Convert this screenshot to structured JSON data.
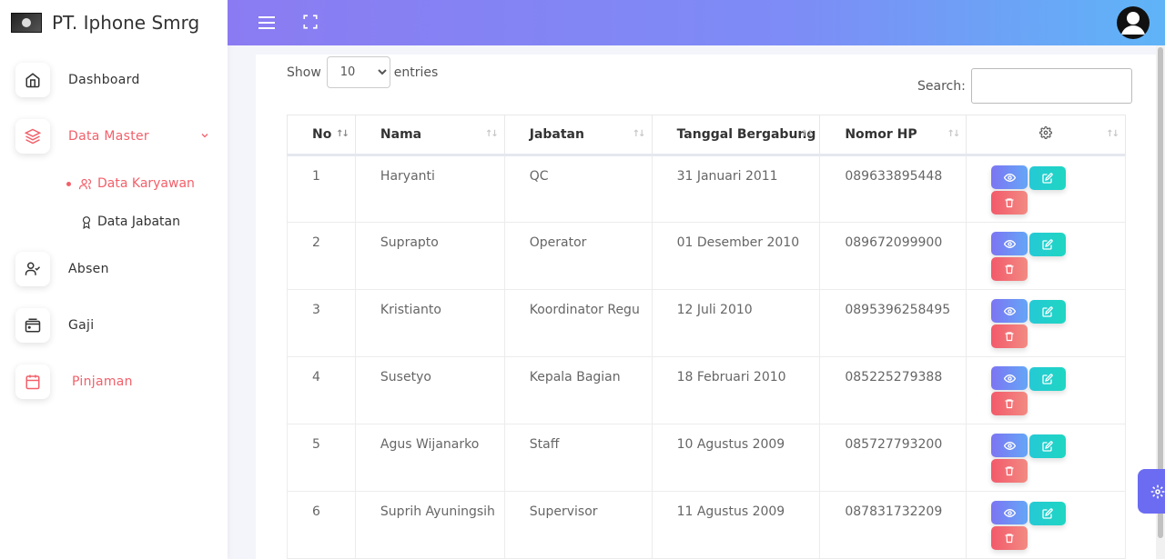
{
  "brand": {
    "title": "PT. Iphone Smrg"
  },
  "sidebar": {
    "items": [
      {
        "label": "Dashboard",
        "icon": "home-icon"
      },
      {
        "label": "Data Master",
        "icon": "layers-icon"
      },
      {
        "label": "Absen",
        "icon": "user-check-icon"
      },
      {
        "label": "Gaji",
        "icon": "wallet-icon"
      },
      {
        "label": "Pinjaman",
        "icon": "calendar-icon"
      }
    ],
    "submenu": [
      {
        "label": "Data Karyawan",
        "icon": "users-icon"
      },
      {
        "label": "Data Jabatan",
        "icon": "award-icon"
      }
    ]
  },
  "table_controls": {
    "show_label": "Show",
    "entries_value": "10",
    "entries_label": "entries",
    "search_label": "Search:"
  },
  "table": {
    "headers": [
      "No",
      "Nama",
      "Jabatan",
      "Tanggal Bergabung",
      "Nomor HP"
    ],
    "rows": [
      {
        "no": "1",
        "nama": "Haryanti",
        "jabatan": "QC",
        "tanggal": "31 Januari 2011",
        "hp": "089633895448"
      },
      {
        "no": "2",
        "nama": "Suprapto",
        "jabatan": "Operator",
        "tanggal": "01 Desember 2010",
        "hp": "089672099900"
      },
      {
        "no": "3",
        "nama": "Kristianto",
        "jabatan": "Koordinator Regu",
        "tanggal": "12 Juli 2010",
        "hp": "0895396258495"
      },
      {
        "no": "4",
        "nama": "Susetyo",
        "jabatan": "Kepala Bagian",
        "tanggal": "18 Februari 2010",
        "hp": "085225279388"
      },
      {
        "no": "5",
        "nama": "Agus Wijanarko",
        "jabatan": "Staff",
        "tanggal": "10 Agustus 2009",
        "hp": "085727793200"
      },
      {
        "no": "6",
        "nama": "Suprih Ayuningsih",
        "jabatan": "Supervisor",
        "tanggal": "11 Agustus 2009",
        "hp": "087831732209"
      }
    ]
  },
  "colors": {
    "accent": "#f2606a",
    "header_start": "#8b7bf2",
    "header_end": "#5fb4f7",
    "view_btn": "#7c75f2",
    "edit_btn": "#25c9d5",
    "delete_btn": "#f25a6a"
  }
}
